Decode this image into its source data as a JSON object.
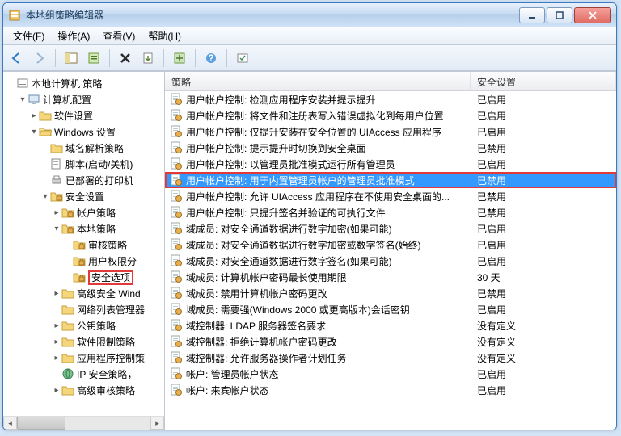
{
  "window": {
    "title": "本地组策略编辑器"
  },
  "menu": {
    "file": "文件(F)",
    "action": "操作(A)",
    "view": "查看(V)",
    "help": "帮助(H)"
  },
  "tree": {
    "root": "本地计算机 策略",
    "n1": "计算机配置",
    "n1a": "软件设置",
    "n1b": "Windows 设置",
    "n1b1": "域名解析策略",
    "n1b2": "脚本(启动/关机)",
    "n1b3": "已部署的打印机",
    "n1b4": "安全设置",
    "n1b4a": "帐户策略",
    "n1b4b": "本地策略",
    "n1b4b1": "审核策略",
    "n1b4b2": "用户权限分",
    "n1b4b3": "安全选项",
    "n1b4c": "高级安全 Wind",
    "n1b4d": "网络列表管理器",
    "n1b4e": "公钥策略",
    "n1b4f": "软件限制策略",
    "n1b4g": "应用程序控制策",
    "n1b4h": "IP 安全策略，",
    "n1b4i": "高级审核策略"
  },
  "columns": {
    "c1": "策略",
    "c2": "安全设置"
  },
  "rows": [
    {
      "name": "用户帐户控制: 检测应用程序安装并提示提升",
      "val": "已启用"
    },
    {
      "name": "用户帐户控制: 将文件和注册表写入错误虚拟化到每用户位置",
      "val": "已启用"
    },
    {
      "name": "用户帐户控制: 仅提升安装在安全位置的 UIAccess 应用程序",
      "val": "已启用"
    },
    {
      "name": "用户帐户控制: 提示提升时切换到安全桌面",
      "val": "已禁用"
    },
    {
      "name": "用户帐户控制: 以管理员批准模式运行所有管理员",
      "val": "已启用"
    },
    {
      "name": "用户帐户控制: 用于内置管理员帐户的管理员批准模式",
      "val": "已禁用",
      "sel": true,
      "hl": true
    },
    {
      "name": "用户帐户控制: 允许 UIAccess 应用程序在不使用安全桌面的...",
      "val": "已禁用"
    },
    {
      "name": "用户帐户控制: 只提升签名并验证的可执行文件",
      "val": "已禁用"
    },
    {
      "name": "域成员: 对安全通道数据进行数字加密(如果可能)",
      "val": "已启用"
    },
    {
      "name": "域成员: 对安全通道数据进行数字加密或数字签名(始终)",
      "val": "已启用"
    },
    {
      "name": "域成员: 对安全通道数据进行数字签名(如果可能)",
      "val": "已启用"
    },
    {
      "name": "域成员: 计算机帐户密码最长使用期限",
      "val": "30 天"
    },
    {
      "name": "域成员: 禁用计算机帐户密码更改",
      "val": "已禁用"
    },
    {
      "name": "域成员: 需要强(Windows 2000 或更高版本)会话密钥",
      "val": "已启用"
    },
    {
      "name": "域控制器: LDAP 服务器签名要求",
      "val": "没有定义"
    },
    {
      "name": "域控制器: 拒绝计算机帐户密码更改",
      "val": "没有定义"
    },
    {
      "name": "域控制器: 允许服务器操作者计划任务",
      "val": "没有定义"
    },
    {
      "name": "帐户: 管理员帐户状态",
      "val": "已启用"
    },
    {
      "name": "帐户: 来宾帐户状态",
      "val": "已启用"
    }
  ]
}
